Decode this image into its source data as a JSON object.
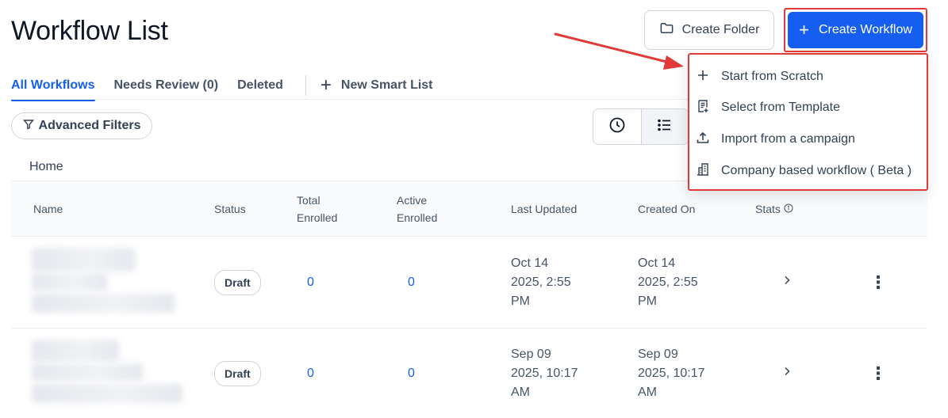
{
  "page": {
    "title": "Workflow List"
  },
  "header": {
    "create_folder_label": "Create Folder",
    "create_workflow_label": "Create Workflow",
    "create_workflow_plus": "+"
  },
  "tabs": [
    {
      "label": "All Workflows",
      "active": true
    },
    {
      "label": "Needs Review (0)",
      "active": false
    },
    {
      "label": "Deleted",
      "active": false
    }
  ],
  "new_smart_list": {
    "plus": "+",
    "label": "New Smart List"
  },
  "filters": {
    "label": "Advanced Filters"
  },
  "breadcrumb": {
    "home": "Home"
  },
  "table": {
    "columns": {
      "name": "Name",
      "status": "Status",
      "total_line1": "Total",
      "total_line2": "Enrolled",
      "active_line1": "Active",
      "active_line2": "Enrolled",
      "last_updated": "Last Updated",
      "created_on": "Created On",
      "stats": "Stats"
    },
    "rows": [
      {
        "status": "Draft",
        "total_enrolled": "0",
        "active_enrolled": "0",
        "updated_1": "Oct 14",
        "updated_2": "2025, 2:55",
        "updated_3": "PM",
        "created_1": "Oct 14",
        "created_2": "2025, 2:55",
        "created_3": "PM"
      },
      {
        "status": "Draft",
        "total_enrolled": "0",
        "active_enrolled": "0",
        "updated_1": "Sep 09",
        "updated_2": "2025, 10:17",
        "updated_3": "AM",
        "created_1": "Sep 09",
        "created_2": "2025, 10:17",
        "created_3": "AM"
      }
    ]
  },
  "dropdown": {
    "items": [
      {
        "label": "Start from Scratch",
        "icon": "plus-icon"
      },
      {
        "label": "Select from Template",
        "icon": "template-icon"
      },
      {
        "label": "Import from a campaign",
        "icon": "upload-icon"
      },
      {
        "label": "Company based workflow ( Beta )",
        "icon": "building-icon"
      }
    ]
  },
  "colors": {
    "accent": "#155eef",
    "annotation": "#e03a3a"
  }
}
